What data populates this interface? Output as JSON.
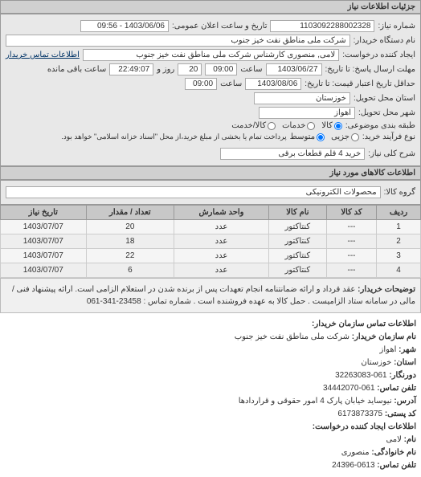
{
  "header": {
    "title": "جزئیات اطلاعات نیاز"
  },
  "form": {
    "need_number_label": "شماره نیاز:",
    "need_number": "1103092288002328",
    "public_datetime_label": "تاریخ و ساعت اعلان عمومی:",
    "public_datetime": "1403/06/06 - 09:56",
    "buyer_org_label": "نام دستگاه خریدار:",
    "buyer_org": "شرکت ملی مناطق نفت خیز جنوب",
    "requester_label": "ایجاد کننده درخواست:",
    "requester": "لامی, منصوری کارشناس شرکت ملی مناطق نفت خیز جنوب",
    "buyer_contact_link": "اطلاعات تماس خریدار",
    "deadline_label": "مهلت ارسال پاسخ: تا تاریخ:",
    "deadline_date": "1403/06/27",
    "deadline_time_label": "ساعت",
    "deadline_time": "09:00",
    "remaining_days": "20",
    "remaining_days_label": "روز و",
    "remaining_time": "22:49:07",
    "remaining_time_label": "ساعت باقی مانده",
    "validity_label": "حداقل تاریخ اعتبار قیمت: تا تاریخ:",
    "validity_date": "1403/08/06",
    "validity_time_label": "ساعت",
    "validity_time": "09:00",
    "delivery_province_label": "استان محل تحویل:",
    "delivery_province": "خوزستان",
    "delivery_city_label": "شهر محل تحویل:",
    "delivery_city": "اهواز",
    "category_label": "طبقه بندی موضوعی:",
    "category_options": {
      "kala": "کالا",
      "khadamat": "خدمات",
      "kala_khadamat": "کالا/خدمت"
    },
    "process_type_label": "نوع فرآیند خرید:",
    "process_options": {
      "small": "متوسط",
      "partial": "جزیی"
    },
    "process_note": "پرداخت تمام یا بخشی از مبلغ خرید،از محل \"اسناد خزانه اسلامی\" خواهد بود.",
    "need_title_label": "شرح کلی نیاز:",
    "need_title": "خرید 4 قلم قطعات برقی"
  },
  "items_section": {
    "header": "اطلاعات کالاهای مورد نیاز",
    "group_label": "گروه کالا:",
    "group": "محصولات الکترونیکی"
  },
  "table": {
    "headers": {
      "row": "ردیف",
      "code": "کد کالا",
      "name": "نام کالا",
      "unit": "واحد شمارش",
      "qty": "تعداد / مقدار",
      "date": "تاریخ نیاز"
    },
    "rows": [
      {
        "row": "1",
        "code": "---",
        "name": "کنتاکتور",
        "unit": "عدد",
        "qty": "20",
        "date": "1403/07/07"
      },
      {
        "row": "2",
        "code": "---",
        "name": "کنتاکتور",
        "unit": "عدد",
        "qty": "18",
        "date": "1403/07/07"
      },
      {
        "row": "3",
        "code": "---",
        "name": "کنتاکتور",
        "unit": "عدد",
        "qty": "22",
        "date": "1403/07/07"
      },
      {
        "row": "4",
        "code": "---",
        "name": "کنتاکتور",
        "unit": "عدد",
        "qty": "6",
        "date": "1403/07/07"
      }
    ]
  },
  "notes": {
    "label": "توضیحات خریدار:",
    "text": "عقد قرداد و ارائه ضمانتنامه انجام تعهدات پس از برنده شدن در استعلام الزامی است. ارائه پیشنهاد فنی /مالی در سامانه ستاد الزامیست . حمل کالا به عهده فروشنده است . شماره تماس : 23458-341-061"
  },
  "contact": {
    "header": "اطلاعات تماس سازمان خریدار:",
    "org_label": "نام سازمان خریدار:",
    "org": "شرکت ملی مناطق نفت خیز جنوب",
    "city_label": "شهر:",
    "city": "اهواز",
    "province_label": "استان:",
    "province": "خوزستان",
    "fax_label": "دورنگار:",
    "fax": "061-32263083",
    "phone_label": "تلفن تماس:",
    "phone": "061-34442070",
    "address_label": "آدرس:",
    "address": "نیوساید خیابان پارک 4 امور حقوقی و قراردادها",
    "postal_label": "کد پستی:",
    "postal": "6173873375",
    "requester_header": "اطلاعات ایجاد کننده درخواست:",
    "lname_label": "نام:",
    "lname": "لامی",
    "fname_label": "نام خانوادگی:",
    "fname": "منصوری",
    "rphone_label": "تلفن تماس:",
    "rphone": "0613-24396"
  }
}
